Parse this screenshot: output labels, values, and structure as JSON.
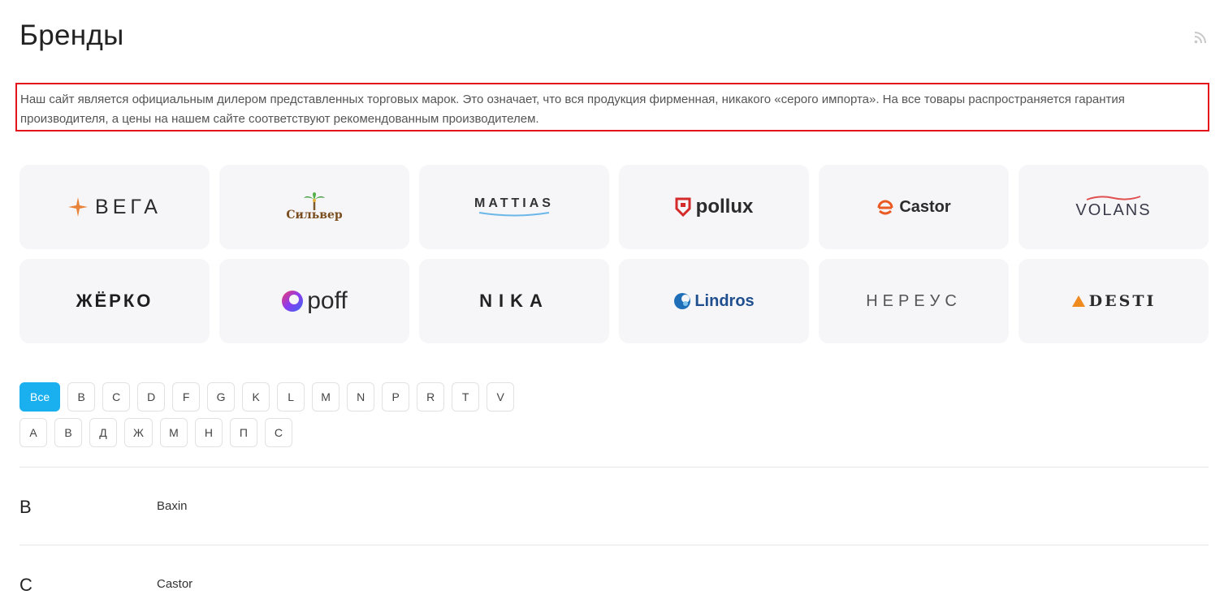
{
  "page": {
    "title": "Бренды",
    "intro": "Наш сайт является официальным дилером представленных торговых марок. Это означает, что вся продукция фирменная, никакого «серого импорта». На все товары распространяется гарантия производителя, а цены на нашем сайте соответствуют рекомендованным производителем."
  },
  "brands": [
    {
      "name": "ВЕГА"
    },
    {
      "name": "Сильвер"
    },
    {
      "name": "MATTIAS"
    },
    {
      "name": "pollux"
    },
    {
      "name": "Castor"
    },
    {
      "name": "VOLANS"
    },
    {
      "name": "ЖЁРКО"
    },
    {
      "name": "poff"
    },
    {
      "name": "NIKA"
    },
    {
      "name": "Lindros"
    },
    {
      "name": "НЕРЕУС"
    },
    {
      "name": "DESTI"
    }
  ],
  "filters": {
    "all_label": "Все",
    "latin": [
      "B",
      "C",
      "D",
      "F",
      "G",
      "K",
      "L",
      "M",
      "N",
      "P",
      "R",
      "T",
      "V"
    ],
    "cyrillic": [
      "А",
      "В",
      "Д",
      "Ж",
      "М",
      "Н",
      "П",
      "С"
    ]
  },
  "sections": [
    {
      "letter": "B",
      "brand": "Baxin"
    },
    {
      "letter": "C",
      "brand": "Castor"
    }
  ],
  "colors": {
    "accent": "#1ab0f0",
    "highlight_border": "#e3141b",
    "card_bg": "#f6f6f9"
  },
  "icons": {
    "feed": "rss-icon"
  }
}
